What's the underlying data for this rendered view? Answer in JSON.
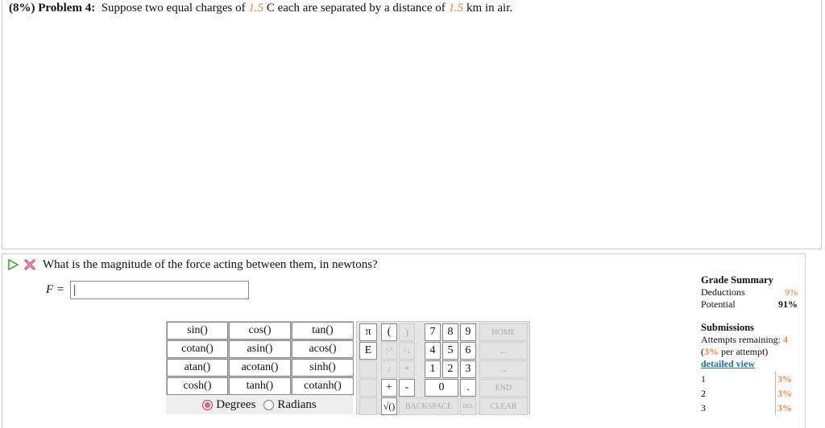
{
  "problem": {
    "percent": "(8%)",
    "label": "Problem 4:",
    "text_1": "Suppose two equal charges of ",
    "charge": "1.5",
    "text_2": " C each are separated by a distance of ",
    "distance": "1.5",
    "text_3": " km in air."
  },
  "question": {
    "text": "What is the magnitude of the force acting between them, in newtons?",
    "var_label": "F =",
    "answer_value": ""
  },
  "func_keys": [
    "sin()",
    "cos()",
    "tan()",
    "cotan()",
    "asin()",
    "acos()",
    "atan()",
    "acotan()",
    "sinh()",
    "cosh()",
    "tanh()",
    "cotanh()"
  ],
  "mode": {
    "degrees": "Degrees",
    "radians": "Radians",
    "selected": "Degrees"
  },
  "num_keys": {
    "pi": "π",
    "e": "E",
    "lparen": "(",
    "rparen": ")",
    "up": "↑^",
    "down": "^↓",
    "slash": "/",
    "star": "*",
    "seven": "7",
    "eight": "8",
    "nine": "9",
    "four": "4",
    "five": "5",
    "six": "6",
    "one": "1",
    "two": "2",
    "three": "3",
    "plus": "+",
    "minus": "-",
    "zero": "0",
    "dot": ".",
    "sqrt": "√()",
    "backspace": "BACKSPACE",
    "del": "DEL",
    "home": "HOME",
    "left": "←",
    "right": "→",
    "end": "END",
    "clear": "CLEAR"
  },
  "grade_summary": {
    "title": "Grade Summary",
    "deductions_label": "Deductions",
    "deductions_value": "9%",
    "potential_label": "Potential",
    "potential_value": "91%"
  },
  "submissions": {
    "title": "Submissions",
    "remaining_label": "Attempts remaining: ",
    "remaining_value": "4",
    "per_attempt_open": "(",
    "per_attempt_value": "3%",
    "per_attempt_close": " per attempt)",
    "detailed_view": "detailed view",
    "rows": [
      {
        "n": "1",
        "p": "3%"
      },
      {
        "n": "2",
        "p": "3%"
      },
      {
        "n": "3",
        "p": "3%"
      }
    ]
  },
  "colors": {
    "highlight": "#f08a3c",
    "link": "#1a6fb0",
    "error": "#e0407a"
  }
}
